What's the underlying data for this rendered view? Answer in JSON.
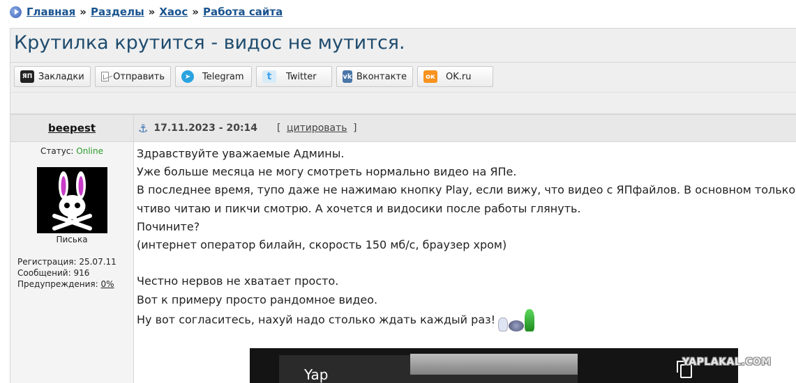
{
  "breadcrumb": {
    "items": [
      "Главная",
      "Разделы",
      "Хаос",
      "Работа сайта"
    ],
    "separator": "»"
  },
  "post_title": "Крутилка крутится - видос не мутится.",
  "share_buttons": [
    {
      "label": "Закладки",
      "icon": "yap-bookmark-icon",
      "icon_text": "ЯП"
    },
    {
      "label": "Отправить",
      "icon": "mail-icon",
      "icon_text": ""
    },
    {
      "label": "Telegram",
      "icon": "telegram-icon",
      "icon_text": "➤"
    },
    {
      "label": "Twitter",
      "icon": "twitter-icon",
      "icon_text": "t"
    },
    {
      "label": "Вконтакте",
      "icon": "vk-icon",
      "icon_text": "vk"
    },
    {
      "label": "OK.ru",
      "icon": "odnoklassniki-icon",
      "icon_text": "ок"
    }
  ],
  "post": {
    "author": "beepest",
    "date": "17.11.2023 - 20:14",
    "quote_label": "цитировать",
    "quote_open": "[",
    "quote_close": "]",
    "user": {
      "status_label": "Статус:",
      "status_value": "Online",
      "avatar_caption": "Писька",
      "reg_label": "Регистрация:",
      "reg_value": "25.07.11",
      "msgs_label": "Сообщений:",
      "msgs_value": "916",
      "warn_label": "Предупреждения:",
      "warn_value": "0%"
    },
    "lines": [
      "Здравствуйте уважаемые Админы.",
      "Уже больше месяца не могу смотреть нормально видео на ЯПе.",
      "В последнее время, тупо даже не нажимаю кнопку Play, если вижу, что видео с ЯПфайлов. В основном только",
      "чтиво читаю и пикчи смотрю. А хочется и видосики после работы глянуть.",
      "Почините?",
      "(интернет оператор билайн, скорость 150 мб/с, браузер хром)",
      "",
      "Честно нервов не хватает просто.",
      "Вот к примеру просто рандомное видео.",
      "Ну вот согласитесь, нахуй надо столько ждать каждый раз!"
    ],
    "video_title": "Yap"
  },
  "watermark": "YAPLAKAL.COM",
  "colors": {
    "link": "#1a5490",
    "title": "#1e4b6e",
    "online": "#2a9a2a",
    "header_bg": "#efefef"
  }
}
